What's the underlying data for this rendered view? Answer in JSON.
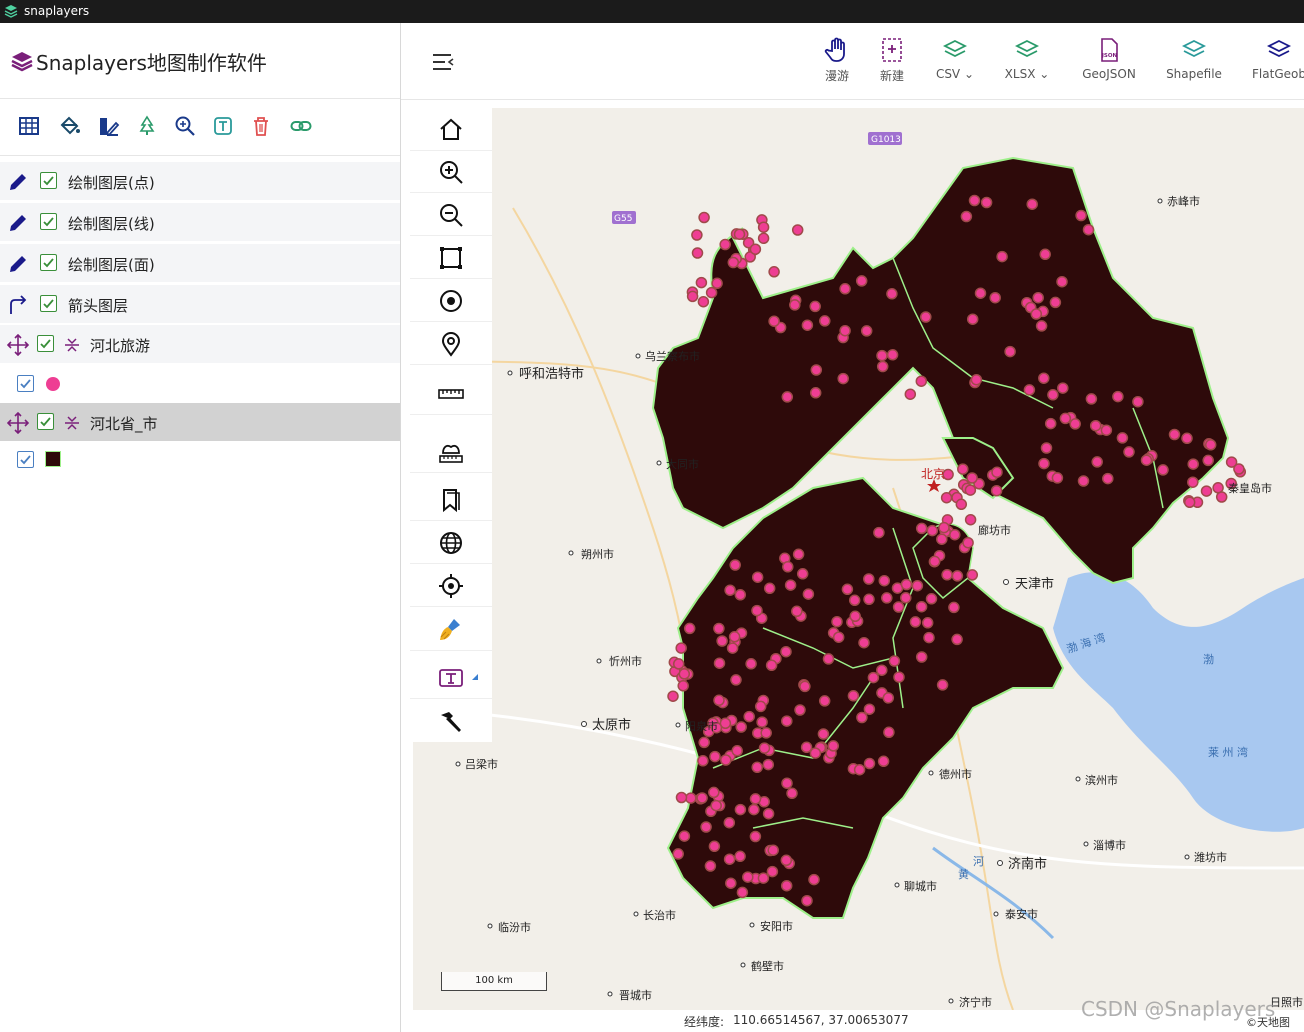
{
  "window": {
    "title": "snaplayers"
  },
  "app": {
    "title": "Snaplayers地图制作软件"
  },
  "sidebar": {
    "tools": [
      "table-icon",
      "paint-bucket-icon",
      "style-icon",
      "tree-icon",
      "zoom-in-icon",
      "text-icon",
      "trash-icon",
      "link-icon"
    ],
    "layers": [
      {
        "label": "绘制图层(点)",
        "checked": true
      },
      {
        "label": "绘制图层(线)",
        "checked": true
      },
      {
        "label": "绘制图层(面)",
        "checked": true
      },
      {
        "label": "箭头图层",
        "checked": true
      },
      {
        "label": "河北旅游",
        "checked": true,
        "style_color": "#ee3e93"
      },
      {
        "label": "河北省_市",
        "checked": true,
        "selected": true,
        "style_color": "#2e0a0a"
      }
    ]
  },
  "toolbar": {
    "buttons": [
      {
        "label": "漫游",
        "icon": "hand-icon"
      },
      {
        "label": "新建",
        "icon": "new-file-icon"
      },
      {
        "label": "CSV",
        "icon": "layers-icon",
        "dropdown": true
      },
      {
        "label": "XLSX",
        "icon": "layers-icon",
        "dropdown": true
      },
      {
        "label": "GeoJSON",
        "icon": "json-file-icon"
      },
      {
        "label": "Shapefile",
        "icon": "layers-icon"
      },
      {
        "label": "FlatGeob",
        "icon": "layers-icon"
      }
    ]
  },
  "map": {
    "cities": [
      "乌兰察布市",
      "呼和浩特市",
      "赤峰市",
      "大同市",
      "北京",
      "秦皇岛市",
      "朔州市",
      "廊坊市",
      "天津市",
      "忻州市",
      "太原市",
      "阳泉市",
      "吕梁市",
      "德州市",
      "滨州市",
      "淄博市",
      "潍坊市",
      "济南市",
      "聊城市",
      "长治市",
      "临汾市",
      "安阳市",
      "泰安市",
      "鹤壁市",
      "晋城市",
      "济宁市",
      "日照市"
    ],
    "road_labels": [
      "G1013",
      "G55"
    ],
    "sea_labels": [
      "渤 海 湾",
      "渤",
      "莱 州 湾"
    ],
    "river_labels": [
      "河",
      "黄"
    ],
    "scale_label": "100 km",
    "attribution": "©天地图 ",
    "colors": {
      "province_fill": "#2e0a0a",
      "province_stroke": "#9ef08a",
      "point_fill": "#ee3e93",
      "point_stroke": "#a04a4a",
      "water": "#a8c8f0"
    }
  },
  "status": {
    "coord_label": "经纬度:",
    "coord_value": "110.66514567, 37.00653077",
    "watermark": "CSDN @Snaplayers"
  }
}
